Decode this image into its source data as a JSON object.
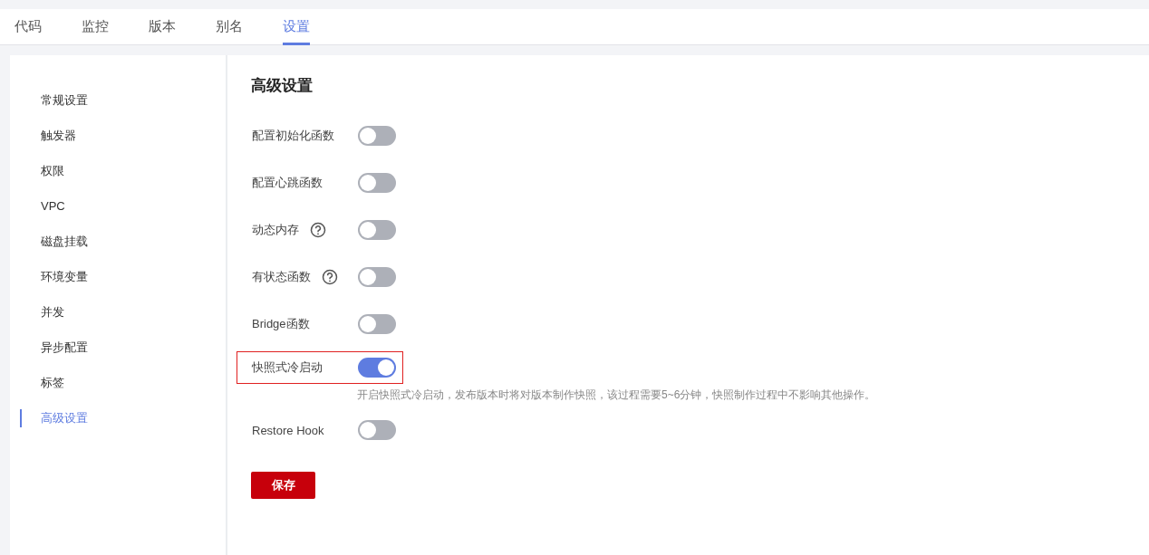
{
  "tabs": [
    {
      "label": "代码",
      "selected": false
    },
    {
      "label": "监控",
      "selected": false
    },
    {
      "label": "版本",
      "selected": false
    },
    {
      "label": "别名",
      "selected": false
    },
    {
      "label": "设置",
      "selected": true
    }
  ],
  "sidebar": {
    "items": [
      {
        "label": "常规设置",
        "selected": false
      },
      {
        "label": "触发器",
        "selected": false
      },
      {
        "label": "权限",
        "selected": false
      },
      {
        "label": "VPC",
        "selected": false
      },
      {
        "label": "磁盘挂载",
        "selected": false
      },
      {
        "label": "环境变量",
        "selected": false
      },
      {
        "label": "并发",
        "selected": false
      },
      {
        "label": "异步配置",
        "selected": false
      },
      {
        "label": "标签",
        "selected": false
      },
      {
        "label": "高级设置",
        "selected": true
      }
    ]
  },
  "content": {
    "title": "高级设置",
    "settings": [
      {
        "label": "配置初始化函数",
        "on": false,
        "help": false,
        "highlighted": false
      },
      {
        "label": "配置心跳函数",
        "on": false,
        "help": false,
        "highlighted": false
      },
      {
        "label": "动态内存",
        "on": false,
        "help": true,
        "highlighted": false
      },
      {
        "label": "有状态函数",
        "on": false,
        "help": true,
        "highlighted": false
      },
      {
        "label": "Bridge函数",
        "on": false,
        "help": false,
        "highlighted": false
      },
      {
        "label": "快照式冷启动",
        "on": true,
        "help": false,
        "highlighted": true,
        "description": "开启快照式冷启动，发布版本时将对版本制作快照，该过程需要5~6分钟，快照制作过程中不影响其他操作。"
      },
      {
        "label": "Restore Hook",
        "on": false,
        "help": false,
        "highlighted": false
      }
    ],
    "save_button": "保存"
  }
}
